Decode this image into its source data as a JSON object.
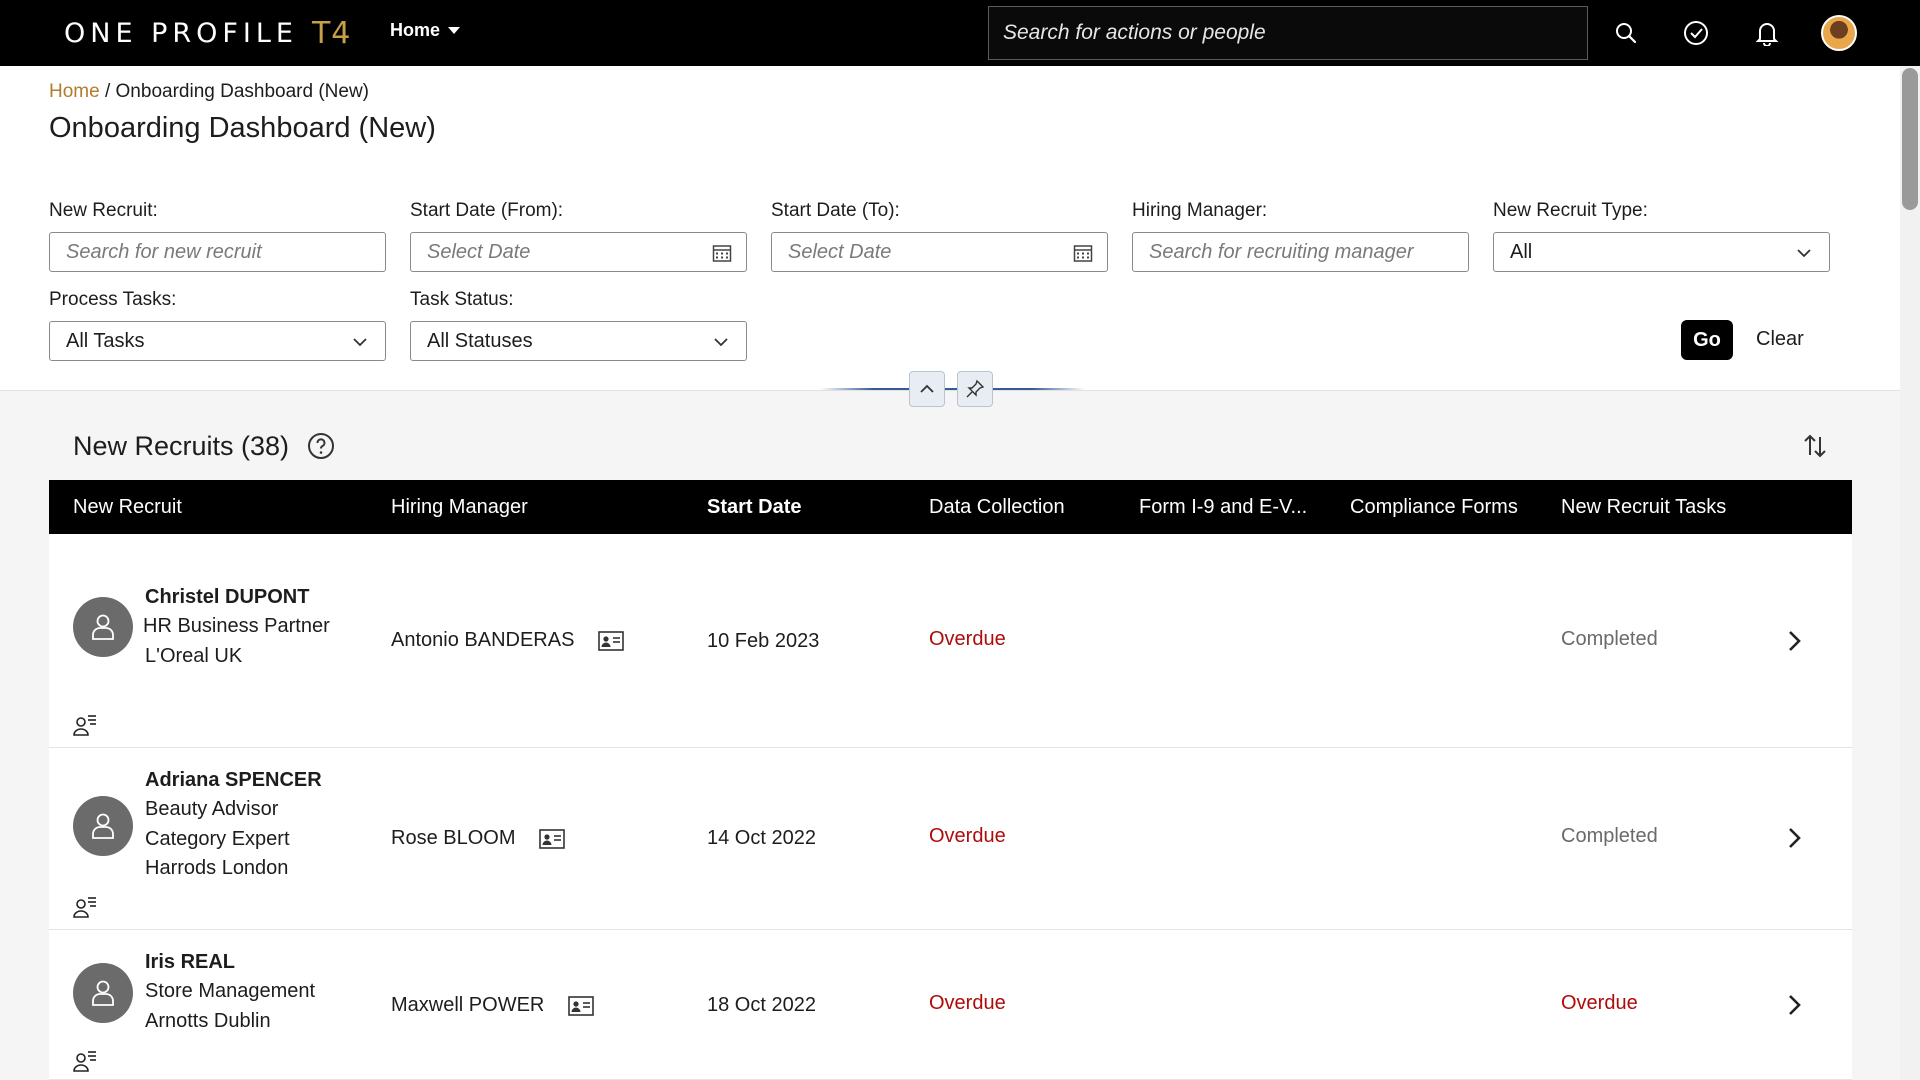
{
  "app": {
    "logo_text": "ONE PROFILE",
    "logo_suffix": "T4",
    "home_menu_label": "Home",
    "search_placeholder": "Search for actions or people",
    "icons": [
      "search-icon",
      "task-check-icon",
      "bell-icon",
      "user-avatar"
    ]
  },
  "breadcrumb": {
    "home": "Home",
    "separator": "/",
    "current": "Onboarding Dashboard (New)"
  },
  "page_title": "Onboarding Dashboard (New)",
  "filters": {
    "new_recruit": {
      "label": "New Recruit:",
      "placeholder": "Search for new recruit"
    },
    "start_from": {
      "label": "Start Date (From):",
      "placeholder": "Select Date"
    },
    "start_to": {
      "label": "Start Date (To):",
      "placeholder": "Select Date"
    },
    "hiring_manager": {
      "label": "Hiring Manager:",
      "placeholder": "Search for recruiting manager"
    },
    "recruit_type": {
      "label": "New Recruit Type:",
      "value": "All"
    },
    "process_tasks": {
      "label": "Process Tasks:",
      "value": "All Tasks"
    },
    "task_status": {
      "label": "Task Status:",
      "value": "All Statuses"
    },
    "go_label": "Go",
    "clear_label": "Clear"
  },
  "recruits_section": {
    "title": "New Recruits (38)",
    "columns": [
      "New Recruit",
      "Hiring Manager",
      "Start Date",
      "Data Collection",
      "Form I-9 and E-V...",
      "Compliance Forms",
      "New Recruit Tasks"
    ],
    "rows": [
      {
        "name": "Christel DUPONT",
        "lines": [
          "HR Business Partner",
          "L'Oreal UK"
        ],
        "manager": "Antonio BANDERAS",
        "start_date": "10 Feb 2023",
        "data_collection": "Overdue",
        "recruit_tasks": "Completed"
      },
      {
        "name": "Adriana SPENCER",
        "lines": [
          "Beauty Advisor",
          "Category Expert",
          "Harrods London"
        ],
        "manager": "Rose BLOOM",
        "start_date": "14 Oct 2022",
        "data_collection": "Overdue",
        "recruit_tasks": "Completed"
      },
      {
        "name": "Iris REAL",
        "lines": [
          "Store Management",
          "Arnotts Dublin"
        ],
        "manager": "Maxwell POWER",
        "start_date": "18 Oct 2022",
        "data_collection": "Overdue",
        "recruit_tasks": "Overdue"
      }
    ]
  },
  "colors": {
    "topbar": "#000000",
    "accent_gold": "#c8a04a",
    "link": "#b07d2c",
    "overdue": "#b00b0b",
    "completed": "#6a6a6a"
  }
}
